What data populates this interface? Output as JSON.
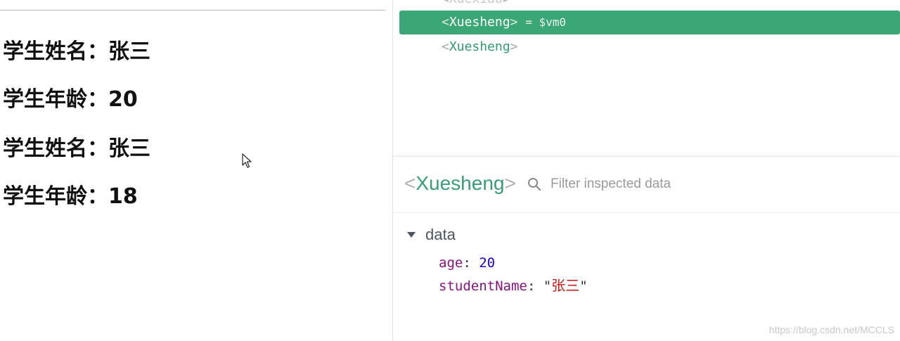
{
  "app": {
    "lines": [
      {
        "label": "学生姓名：",
        "value": "张三"
      },
      {
        "label": "学生年龄：",
        "value": "20"
      },
      {
        "label": "学生姓名：",
        "value": "张三"
      },
      {
        "label": "学生年龄：",
        "value": "18"
      }
    ]
  },
  "tree": {
    "partial_row": "Xuexiao",
    "selected_row": {
      "name": "Xuesheng",
      "vm_ref": "= $vm0"
    },
    "other_row": "Xuesheng"
  },
  "inspector": {
    "component_name": "Xuesheng",
    "filter_placeholder": "Filter inspected data",
    "section_label": "data",
    "props": [
      {
        "key": "age",
        "value": "20"
      },
      {
        "key": "studentName",
        "value": "张三"
      }
    ]
  },
  "watermark": "https://blog.csdn.net/MCCLS",
  "colors": {
    "accent_green": "#3ba776",
    "component_green": "#3a9e74",
    "prop_key": "#881280",
    "prop_number": "#1c00cf",
    "prop_string": "#c41a16"
  },
  "icons": [
    "mouse-pointer-icon",
    "search-icon",
    "triangle-down-icon"
  ]
}
